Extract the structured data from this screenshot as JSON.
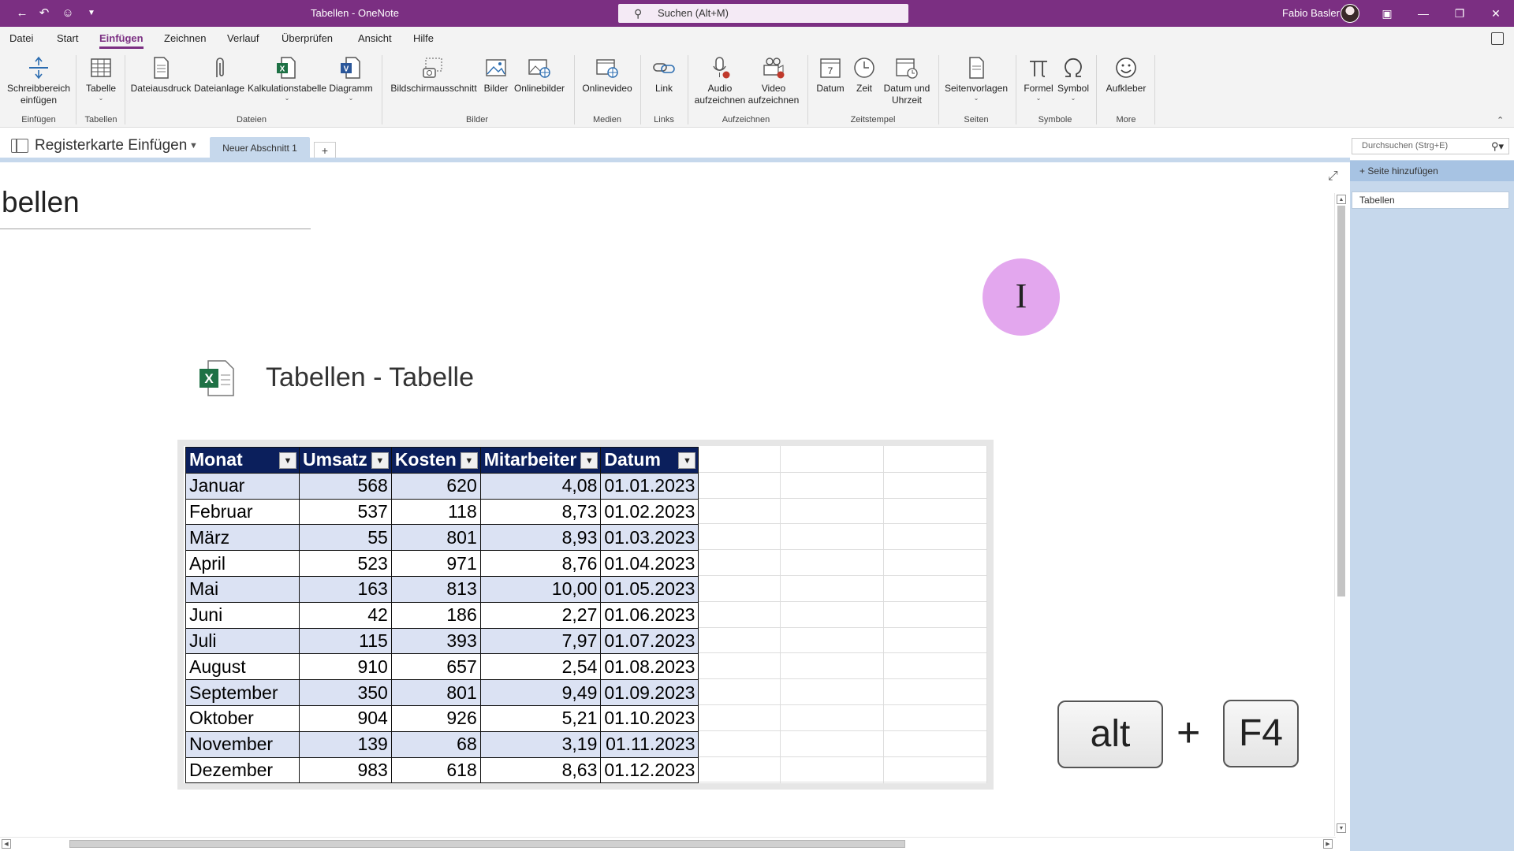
{
  "titlebar": {
    "doc_title": "Tabellen  -  OneNote",
    "search_label": "Suchen (Alt+M)",
    "user_name": "Fabio Basler"
  },
  "menu": {
    "tabs": [
      "Datei",
      "Start",
      "Einfügen",
      "Zeichnen",
      "Verlauf",
      "Überprüfen",
      "Ansicht",
      "Hilfe"
    ],
    "active": "Einfügen"
  },
  "ribbon": {
    "buttons": {
      "schreibbereich": "Schreibbereich\neinfügen",
      "tabelle": "Tabelle",
      "dateiausdruck": "Dateiausdruck",
      "dateianlage": "Dateianlage",
      "kalkulationstabelle": "Kalkulationstabelle",
      "diagramm": "Diagramm",
      "bildschirmausschnitt": "Bildschirmausschnitt",
      "bilder": "Bilder",
      "onlinebilder": "Onlinebilder",
      "onlinevideo": "Onlinevideo",
      "link": "Link",
      "audio": "Audio\naufzeichnen",
      "video": "Video\naufzeichnen",
      "datum": "Datum",
      "zeit": "Zeit",
      "datum_uhrzeit": "Datum und\nUhrzeit",
      "seitenvorlagen": "Seitenvorlagen",
      "formel": "Formel",
      "symbol": "Symbol",
      "aufkleber": "Aufkleber"
    },
    "groups": {
      "einfuegen": "Einfügen",
      "tabellen": "Tabellen",
      "dateien": "Dateien",
      "bilder": "Bilder",
      "medien": "Medien",
      "links": "Links",
      "aufzeichnen": "Aufzeichnen",
      "zeitstempel": "Zeitstempel",
      "seiten": "Seiten",
      "symbole": "Symbole",
      "more": "More"
    },
    "icon_glyphs": {
      "datum": "7"
    }
  },
  "notebook": {
    "name": "Registerkarte Einfügen",
    "section_tab": "Neuer Abschnitt 1",
    "add_section": "+",
    "search_placeholder": "Durchsuchen (Strg+E)"
  },
  "page": {
    "title": "bellen",
    "embedded_file_name": "Tabellen - Tabelle"
  },
  "table": {
    "headers": [
      "Monat",
      "Umsatz",
      "Kosten",
      "Mitarbeiter",
      "Datum"
    ],
    "rows": [
      [
        "Januar",
        "568",
        "620",
        "4,08",
        "01.01.2023"
      ],
      [
        "Februar",
        "537",
        "118",
        "8,73",
        "01.02.2023"
      ],
      [
        "März",
        "55",
        "801",
        "8,93",
        "01.03.2023"
      ],
      [
        "April",
        "523",
        "971",
        "8,76",
        "01.04.2023"
      ],
      [
        "Mai",
        "163",
        "813",
        "10,00",
        "01.05.2023"
      ],
      [
        "Juni",
        "42",
        "186",
        "2,27",
        "01.06.2023"
      ],
      [
        "Juli",
        "115",
        "393",
        "7,97",
        "01.07.2023"
      ],
      [
        "August",
        "910",
        "657",
        "2,54",
        "01.08.2023"
      ],
      [
        "September",
        "350",
        "801",
        "9,49",
        "01.09.2023"
      ],
      [
        "Oktober",
        "904",
        "926",
        "5,21",
        "01.10.2023"
      ],
      [
        "November",
        "139",
        "68",
        "3,19",
        "01.11.2023"
      ],
      [
        "Dezember",
        "983",
        "618",
        "8,63",
        "01.12.2023"
      ]
    ]
  },
  "keys": {
    "key1": "alt",
    "plus": "+",
    "key2": "F4"
  },
  "pagepane": {
    "add_page": "Seite hinzufügen",
    "pages": [
      "Tabellen"
    ]
  },
  "colors": {
    "brand": "#7b2f82",
    "table_header": "#0b1f5c",
    "table_band": "#dbe2f3",
    "pane": "#c6d8ec",
    "cursor_halo": "#e3a7ee"
  }
}
